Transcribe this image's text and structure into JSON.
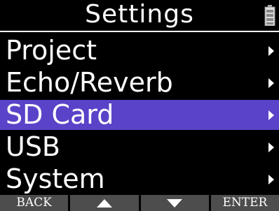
{
  "header": {
    "title": "Settings",
    "battery_icon": "battery-icon"
  },
  "menu": {
    "items": [
      {
        "label": "Project",
        "arrow_icon": "chevron-right-icon"
      },
      {
        "label": "Echo/Reverb",
        "arrow_icon": "chevron-right-icon"
      },
      {
        "label": "SD Card",
        "arrow_icon": "chevron-right-icon",
        "selected": true
      },
      {
        "label": "USB",
        "arrow_icon": "chevron-right-icon"
      },
      {
        "label": "System",
        "arrow_icon": "chevron-right-icon"
      }
    ]
  },
  "footer": {
    "back_label": "BACK",
    "up_icon": "up-triangle-icon",
    "down_icon": "down-triangle-icon",
    "enter_label": "ENTER"
  },
  "colors": {
    "background": "#000000",
    "selected": "#5a43c8",
    "footer_button": "#4d4d4d",
    "text": "#ffffff"
  }
}
